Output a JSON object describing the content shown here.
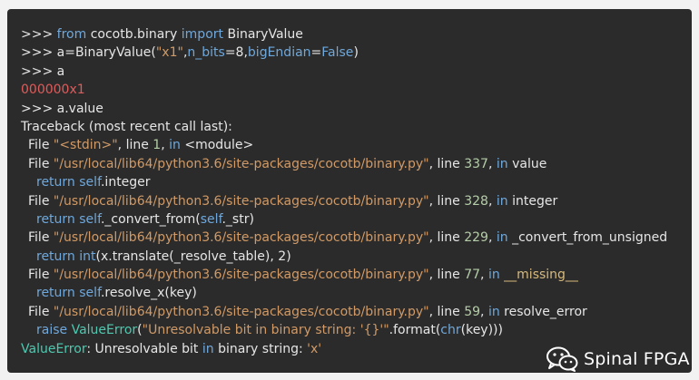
{
  "lines": [
    {
      "segments": [
        {
          "t": ">>> ",
          "c": "text"
        },
        {
          "t": "from",
          "c": "kw"
        },
        {
          "t": " cocotb.binary ",
          "c": "text"
        },
        {
          "t": "import",
          "c": "kw"
        },
        {
          "t": " BinaryValue",
          "c": "text"
        }
      ]
    },
    {
      "segments": [
        {
          "t": ">>> a=BinaryValue(",
          "c": "text"
        },
        {
          "t": "\"x1\"",
          "c": "str"
        },
        {
          "t": ",",
          "c": "text"
        },
        {
          "t": "n_bits",
          "c": "kw"
        },
        {
          "t": "=8,",
          "c": "text"
        },
        {
          "t": "bigEndian",
          "c": "kw"
        },
        {
          "t": "=",
          "c": "text"
        },
        {
          "t": "False",
          "c": "kw"
        },
        {
          "t": ")",
          "c": "text"
        }
      ]
    },
    {
      "segments": [
        {
          "t": ">>> a",
          "c": "text"
        }
      ]
    },
    {
      "segments": [
        {
          "t": "000000x1",
          "c": "red"
        }
      ]
    },
    {
      "segments": [
        {
          "t": ">>> a.value",
          "c": "text"
        }
      ]
    },
    {
      "segments": [
        {
          "t": "Traceback (most recent call last):",
          "c": "text"
        }
      ]
    },
    {
      "indent": 1,
      "segments": [
        {
          "t": "File ",
          "c": "text"
        },
        {
          "t": "\"<stdin>\"",
          "c": "str"
        },
        {
          "t": ", line ",
          "c": "text"
        },
        {
          "t": "1",
          "c": "num"
        },
        {
          "t": ", ",
          "c": "text"
        },
        {
          "t": "in",
          "c": "kw"
        },
        {
          "t": " <module>",
          "c": "text"
        }
      ]
    },
    {
      "indent": 1,
      "segments": [
        {
          "t": "File ",
          "c": "text"
        },
        {
          "t": "\"/usr/local/lib64/python3.6/site-packages/cocotb/binary.py\"",
          "c": "str"
        },
        {
          "t": ", line ",
          "c": "text"
        },
        {
          "t": "337",
          "c": "num"
        },
        {
          "t": ", ",
          "c": "text"
        },
        {
          "t": "in",
          "c": "kw"
        },
        {
          "t": " value",
          "c": "text"
        }
      ]
    },
    {
      "indent": 2,
      "segments": [
        {
          "t": "return",
          "c": "kw"
        },
        {
          "t": " ",
          "c": "text"
        },
        {
          "t": "self",
          "c": "kw"
        },
        {
          "t": ".integer",
          "c": "text"
        }
      ]
    },
    {
      "indent": 1,
      "segments": [
        {
          "t": "File ",
          "c": "text"
        },
        {
          "t": "\"/usr/local/lib64/python3.6/site-packages/cocotb/binary.py\"",
          "c": "str"
        },
        {
          "t": ", line ",
          "c": "text"
        },
        {
          "t": "328",
          "c": "num"
        },
        {
          "t": ", ",
          "c": "text"
        },
        {
          "t": "in",
          "c": "kw"
        },
        {
          "t": " integer",
          "c": "text"
        }
      ]
    },
    {
      "indent": 2,
      "segments": [
        {
          "t": "return",
          "c": "kw"
        },
        {
          "t": " ",
          "c": "text"
        },
        {
          "t": "self",
          "c": "kw"
        },
        {
          "t": "._convert_from(",
          "c": "text"
        },
        {
          "t": "self",
          "c": "kw"
        },
        {
          "t": "._str)",
          "c": "text"
        }
      ]
    },
    {
      "indent": 1,
      "segments": [
        {
          "t": "File ",
          "c": "text"
        },
        {
          "t": "\"/usr/local/lib64/python3.6/site-packages/cocotb/binary.py\"",
          "c": "str"
        },
        {
          "t": ", line ",
          "c": "text"
        },
        {
          "t": "229",
          "c": "num"
        },
        {
          "t": ", ",
          "c": "text"
        },
        {
          "t": "in",
          "c": "kw"
        },
        {
          "t": " _convert_from_unsigned",
          "c": "text"
        }
      ]
    },
    {
      "indent": 2,
      "segments": [
        {
          "t": "return",
          "c": "kw"
        },
        {
          "t": " ",
          "c": "text"
        },
        {
          "t": "int",
          "c": "kw"
        },
        {
          "t": "(x.translate(_resolve_table), 2)",
          "c": "text"
        }
      ]
    },
    {
      "indent": 1,
      "segments": [
        {
          "t": "File ",
          "c": "text"
        },
        {
          "t": "\"/usr/local/lib64/python3.6/site-packages/cocotb/binary.py\"",
          "c": "str"
        },
        {
          "t": ", line ",
          "c": "text"
        },
        {
          "t": "77",
          "c": "num"
        },
        {
          "t": ", ",
          "c": "text"
        },
        {
          "t": "in",
          "c": "kw"
        },
        {
          "t": " ",
          "c": "text"
        },
        {
          "t": "__missing__",
          "c": "fn"
        }
      ]
    },
    {
      "indent": 2,
      "segments": [
        {
          "t": "return",
          "c": "kw"
        },
        {
          "t": " ",
          "c": "text"
        },
        {
          "t": "self",
          "c": "kw"
        },
        {
          "t": ".resolve_x(key)",
          "c": "text"
        }
      ]
    },
    {
      "indent": 1,
      "segments": [
        {
          "t": "File ",
          "c": "text"
        },
        {
          "t": "\"/usr/local/lib64/python3.6/site-packages/cocotb/binary.py\"",
          "c": "str"
        },
        {
          "t": ", line ",
          "c": "text"
        },
        {
          "t": "59",
          "c": "num"
        },
        {
          "t": ", ",
          "c": "text"
        },
        {
          "t": "in",
          "c": "kw"
        },
        {
          "t": " resolve_error",
          "c": "text"
        }
      ]
    },
    {
      "indent": 2,
      "segments": [
        {
          "t": "raise",
          "c": "kw"
        },
        {
          "t": " ",
          "c": "text"
        },
        {
          "t": "ValueError",
          "c": "cls"
        },
        {
          "t": "(",
          "c": "text"
        },
        {
          "t": "\"Unresolvable bit in binary string: '{}'\"",
          "c": "str"
        },
        {
          "t": ".format(",
          "c": "text"
        },
        {
          "t": "chr",
          "c": "kw"
        },
        {
          "t": "(key)))",
          "c": "text"
        }
      ]
    },
    {
      "segments": [
        {
          "t": "ValueError",
          "c": "cls"
        },
        {
          "t": ": Unresolvable bit ",
          "c": "text"
        },
        {
          "t": "in",
          "c": "kw"
        },
        {
          "t": " binary string: ",
          "c": "text"
        },
        {
          "t": "'x'",
          "c": "str"
        }
      ]
    }
  ],
  "watermark": {
    "icon": "wechat-icon",
    "text": "Spinal FPGA"
  },
  "colors": {
    "background": "#2b2b2b",
    "text": "#e6e6e6",
    "keyword": "#6fa8dc",
    "string": "#d19a66",
    "number": "#b5cea8",
    "error_output": "#e05b5b"
  }
}
